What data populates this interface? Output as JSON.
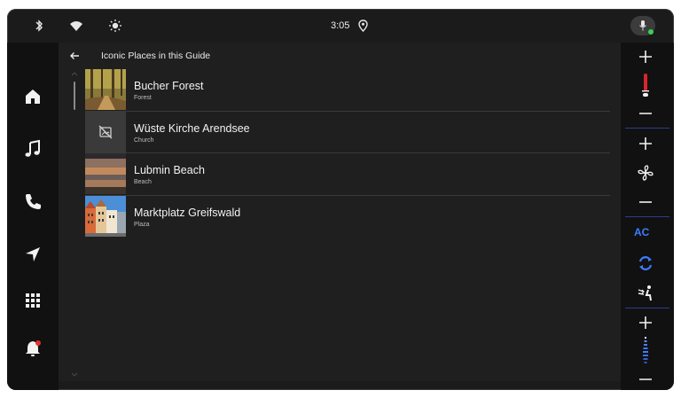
{
  "status_bar": {
    "time": "3:05",
    "icons": [
      "bluetooth-icon",
      "wifi-icon",
      "brightness-icon",
      "location-pin-icon",
      "microphone-icon"
    ]
  },
  "left_rail": {
    "items": [
      "home-icon",
      "music-note-icon",
      "phone-icon",
      "navigation-arrow-icon",
      "app-grid-icon",
      "notification-bell-icon"
    ]
  },
  "header": {
    "title": "Iconic Places in this Guide"
  },
  "places": [
    {
      "name": "Bucher Forest",
      "category": "Forest",
      "thumbnail": "forest-photo"
    },
    {
      "name": "Wüste Kirche Arendsee",
      "category": "Church",
      "thumbnail": "no-image-icon"
    },
    {
      "name": "Lubmin Beach",
      "category": "Beach",
      "thumbnail": "beach-sunset-photo"
    },
    {
      "name": "Marktplatz Greifswald",
      "category": "Plaza",
      "thumbnail": "plaza-buildings-photo"
    }
  ],
  "right_rail": {
    "ac_label": "AC",
    "accent_color": "#3d7dff",
    "temp_color": "#d9262c",
    "icons": [
      "plus-icon",
      "temperature-icon",
      "minus-icon",
      "plus-icon",
      "fan-icon",
      "minus-icon",
      "recirculate-icon",
      "seat-airflow-icon",
      "plus-icon",
      "fan-speed-icon",
      "minus-icon"
    ]
  }
}
